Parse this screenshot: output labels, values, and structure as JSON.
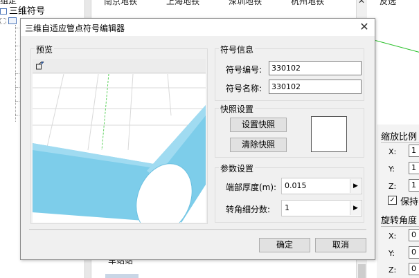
{
  "background": {
    "tree": {
      "top_fragment": "组定",
      "root_label": "三维符号"
    },
    "tabs": [
      "南京地铁",
      "上海地铁",
      "深圳地铁",
      "杭州地铁"
    ],
    "bottom_label": "车站站",
    "right_top": "反选",
    "right_panel": {
      "scale_title": "缩放比例",
      "scale_fields": [
        {
          "label": "X:",
          "value": "1"
        },
        {
          "label": "Y:",
          "value": "1"
        },
        {
          "label": "Z:",
          "value": "1"
        }
      ],
      "keep_label": "保持",
      "keep_checked": true,
      "rotation_title": "旋转角度",
      "rotation_fields": [
        {
          "label": "X:",
          "value": "0"
        },
        {
          "label": "Y:",
          "value": "0"
        },
        {
          "label": "Z:",
          "value": "0"
        }
      ]
    }
  },
  "dialog": {
    "title": "三维自适应管点符号编辑器",
    "preview": {
      "label": "预览",
      "tool_icon": "cube-view-icon",
      "pipe_color": "#7dcdea",
      "grid_color": "#d9d9d9"
    },
    "info": {
      "label": "符号信息",
      "code_label": "符号编号:",
      "code_value": "330102",
      "name_label": "符号名称:",
      "name_value": "330102"
    },
    "snapshot": {
      "label": "快照设置",
      "set_button": "设置快照",
      "clear_button": "清除快照"
    },
    "params": {
      "label": "参数设置",
      "thickness_label": "端部厚度(m):",
      "thickness_value": "0.015",
      "segments_label": "转角细分数:",
      "segments_value": "1"
    },
    "ok_button": "确定",
    "cancel_button": "取消"
  }
}
